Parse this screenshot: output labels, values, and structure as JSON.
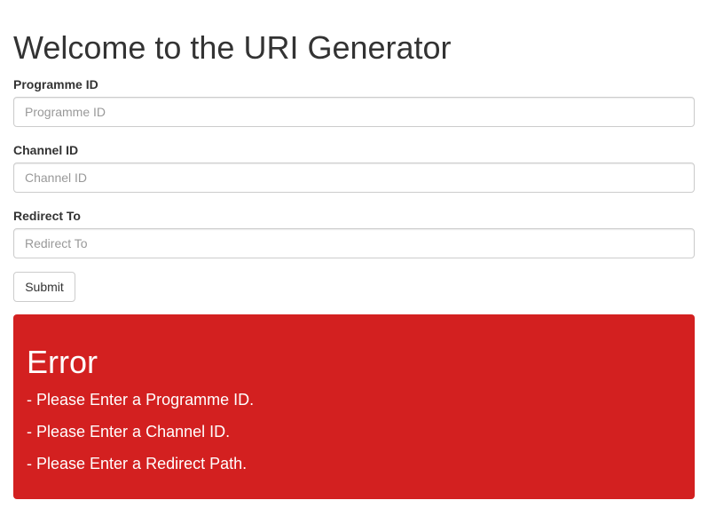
{
  "header": {
    "title": "Welcome to the URI Generator"
  },
  "form": {
    "programme_id": {
      "label": "Programme ID",
      "placeholder": "Programme ID",
      "value": ""
    },
    "channel_id": {
      "label": "Channel ID",
      "placeholder": "Channel ID",
      "value": ""
    },
    "redirect_to": {
      "label": "Redirect To",
      "placeholder": "Redirect To",
      "value": ""
    },
    "submit_label": "Submit"
  },
  "error": {
    "title": "Error",
    "items": [
      "- Please Enter a Programme ID.",
      "- Please Enter a Channel ID.",
      "- Please Enter a Redirect Path."
    ],
    "background_color": "#d32020",
    "text_color": "#ffffff"
  }
}
